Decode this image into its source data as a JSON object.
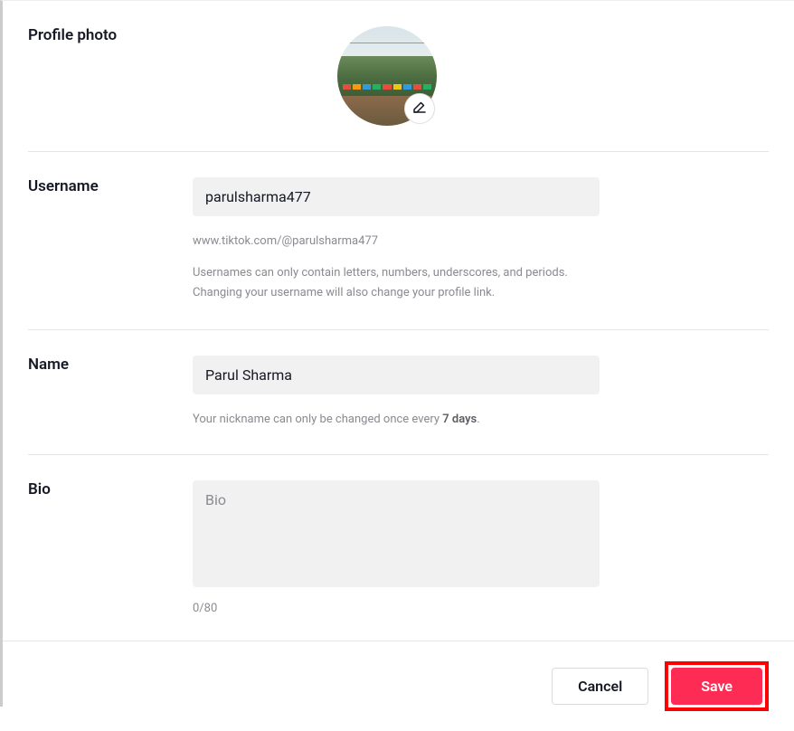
{
  "profilePhoto": {
    "label": "Profile photo"
  },
  "username": {
    "label": "Username",
    "value": "parulsharma477",
    "url": "www.tiktok.com/@parulsharma477",
    "helper": "Usernames can only contain letters, numbers, underscores, and periods. Changing your username will also change your profile link."
  },
  "name": {
    "label": "Name",
    "value": "Parul Sharma",
    "helperPrefix": "Your nickname can only be changed once every ",
    "helperStrong": "7 days",
    "helperSuffix": "."
  },
  "bio": {
    "label": "Bio",
    "placeholder": "Bio",
    "value": "",
    "counter": "0/80"
  },
  "footer": {
    "cancel": "Cancel",
    "save": "Save"
  }
}
